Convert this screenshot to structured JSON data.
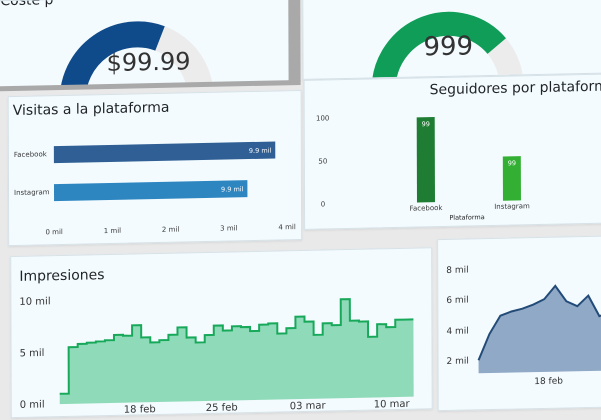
{
  "cards": {
    "cost_kpi": {
      "title_fragment": "Coste p",
      "value": "$99.99",
      "gauge_fraction": 0.62,
      "gauge_color": "#0f4a8a"
    },
    "followers_kpi": {
      "value": "999",
      "gauge_fraction": 0.78,
      "gauge_color": "#0f9d58"
    },
    "visits": {
      "title": "Visitas a la plataforma",
      "chart_data": {
        "type": "bar",
        "orientation": "horizontal",
        "categories": [
          "Facebook",
          "Instagram"
        ],
        "values": [
          9900,
          9900
        ],
        "labels": [
          "9.9 mil",
          "9.9 mil"
        ],
        "x_ticks": [
          "0 mil",
          "1 mil",
          "2 mil",
          "3 mil",
          "4 mil"
        ],
        "colors": [
          "#2f5f95",
          "#2e86c1"
        ]
      }
    },
    "followers": {
      "title": "Seguidores por plataforma",
      "chart_data": {
        "type": "bar",
        "categories": [
          "Facebook",
          "Instagram"
        ],
        "values": [
          99,
          99
        ],
        "y_ticks": [
          "100",
          "50",
          "0"
        ],
        "xlabel": "Plataforma",
        "colors": [
          "#1e7d32",
          "#33b033"
        ]
      }
    },
    "impressions": {
      "title": "Impresiones",
      "chart_data": {
        "type": "area",
        "y_ticks": [
          "10 mil",
          "5 mil",
          "0 mil"
        ],
        "x_ticks": [
          "18 feb",
          "25 feb",
          "03 mar",
          "10 mar"
        ],
        "values": [
          1,
          5.5,
          5.8,
          5.9,
          6.0,
          6.1,
          6.6,
          6.5,
          7.5,
          6.3,
          5.8,
          6.0,
          6.5,
          7.2,
          6.2,
          5.7,
          6.4,
          7.3,
          6.8,
          7.2,
          7.1,
          6.7,
          7.3,
          7.4,
          6.4,
          6.9,
          8.0,
          7.5,
          6.2,
          7.3,
          7.1,
          9.6,
          7.5,
          7.4,
          5.9,
          7.1,
          6.8,
          7.5,
          7.5
        ],
        "line_color": "#18a85a",
        "fill_color": "#8fdbb9"
      }
    },
    "second_area": {
      "chart_data": {
        "type": "area",
        "y_ticks": [
          "8 mil",
          "6 mil",
          "4 mil",
          "2 mil"
        ],
        "x_ticks": [
          "18 feb"
        ],
        "values": [
          1.0,
          3.0,
          4.4,
          4.7,
          4.9,
          5.2,
          5.6,
          6.6,
          5.4,
          5.0,
          5.8,
          4.2,
          4.5
        ],
        "line_color": "#234b78",
        "fill_color": "#8fa9c6"
      }
    }
  }
}
